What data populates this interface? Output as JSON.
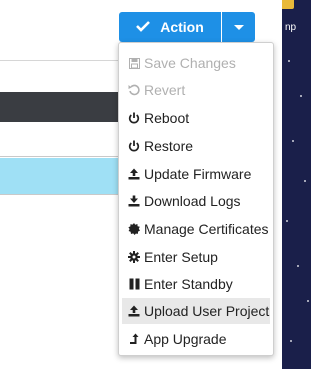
{
  "toolbar": {
    "action_label": "Action",
    "side_label": "np"
  },
  "menu": {
    "items": [
      {
        "label": "Save Changes",
        "icon": "save-icon",
        "disabled": true
      },
      {
        "label": "Revert",
        "icon": "revert-icon",
        "disabled": true
      },
      {
        "label": "Reboot",
        "icon": "power-icon",
        "disabled": false
      },
      {
        "label": "Restore",
        "icon": "power-icon",
        "disabled": false
      },
      {
        "label": "Update Firmware",
        "icon": "upload-icon",
        "disabled": false
      },
      {
        "label": "Download Logs",
        "icon": "download-icon",
        "disabled": false
      },
      {
        "label": "Manage Certificates",
        "icon": "certificate-icon",
        "disabled": false
      },
      {
        "label": "Enter Setup",
        "icon": "gear-icon",
        "disabled": false
      },
      {
        "label": "Enter Standby",
        "icon": "pause-icon",
        "disabled": false
      },
      {
        "label": "Upload User Project",
        "icon": "upload-icon",
        "disabled": false,
        "highlighted": true
      },
      {
        "label": "App Upgrade",
        "icon": "upgrade-arrow-icon",
        "disabled": false
      }
    ]
  },
  "colors": {
    "accent": "#1e90e6",
    "disabled_text": "#b0b0b0",
    "highlight": "#e8e8e8"
  }
}
